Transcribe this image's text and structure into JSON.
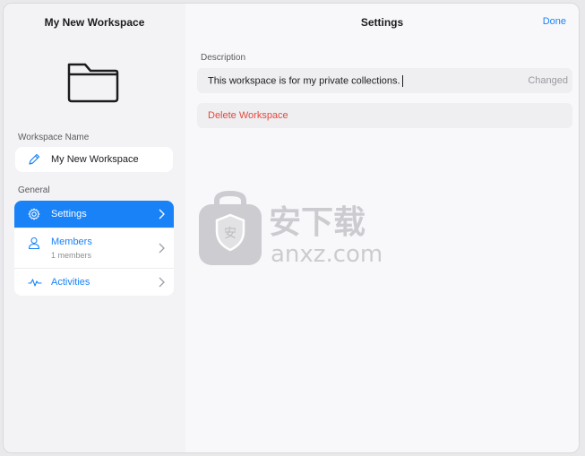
{
  "sidebar": {
    "title": "My New Workspace",
    "workspace_name_label": "Workspace Name",
    "workspace_name_value": "My New Workspace",
    "general_label": "General",
    "items": [
      {
        "label": "Settings",
        "sub": "",
        "icon": "gear-icon",
        "active": true
      },
      {
        "label": "Members",
        "sub": "1 members",
        "icon": "person-icon",
        "active": false
      },
      {
        "label": "Activities",
        "sub": "",
        "icon": "activity-icon",
        "active": false
      }
    ]
  },
  "main": {
    "title": "Settings",
    "done_label": "Done",
    "description_label": "Description",
    "description_value": "This workspace is for my private collections.",
    "changed_label": "Changed",
    "delete_label": "Delete Workspace"
  },
  "watermark": {
    "text_cn": "安下载",
    "text_en": "anxz.com"
  },
  "colors": {
    "accent": "#1a82f7",
    "danger": "#e5483a",
    "sidebar_bg": "#f3f3f6"
  }
}
